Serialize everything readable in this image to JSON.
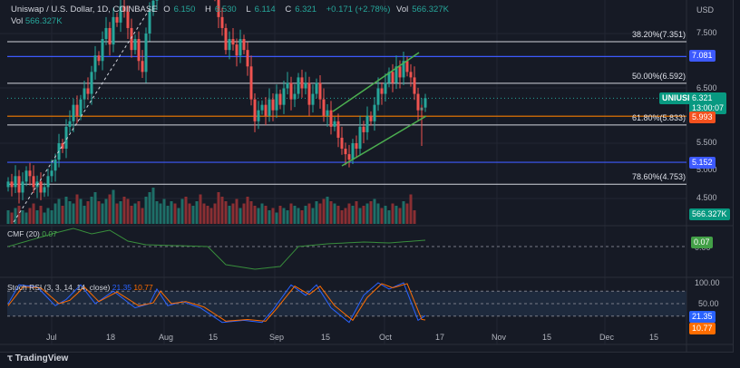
{
  "header": {
    "symbol": "Uniswap / U.S. Dollar, 1D, COINBASE",
    "o_label": "O",
    "o": "6.150",
    "h_label": "H",
    "h": "6.530",
    "l_label": "L",
    "l": "6.114",
    "c_label": "C",
    "c": "6.321",
    "change": "+0.171 (+2.78%)",
    "vol_label": "Vol",
    "vol": "566.327K"
  },
  "volume_legend": {
    "label": "Vol",
    "value": "566.327K"
  },
  "price_axis": {
    "currency": "USD",
    "ticks": [
      "7.500",
      "6.500",
      "5.500",
      "5.000",
      "4.500"
    ]
  },
  "price_labels": {
    "symbol_tag": "UNIUSD",
    "last_price": "6.321",
    "countdown": "13:00:07",
    "level_orange": "5.993",
    "level_blue_high": "7.081",
    "level_blue_low": "5.152",
    "volume": "566.327K"
  },
  "fib_levels": [
    {
      "label": "38.20%(7.351)",
      "price": 7.351
    },
    {
      "label": "50.00%(6.592)",
      "price": 6.592
    },
    {
      "label": "61.80%(5.833)",
      "price": 5.833
    },
    {
      "label": "78.60%(4.753)",
      "price": 4.753
    }
  ],
  "horizontal_levels": [
    {
      "price": 7.081,
      "color": "#3d5afe"
    },
    {
      "price": 5.152,
      "color": "#3d5afe"
    },
    {
      "price": 5.993,
      "color": "#f57c00"
    }
  ],
  "cmf": {
    "label": "CMF (20)",
    "value": "0.07",
    "zero_label": "0.00",
    "color": "#388e3c"
  },
  "stoch": {
    "label": "Stoch RSI (3, 3, 14, 14, close)",
    "k": "21.35",
    "d": "10.77",
    "ticks": [
      "100.00",
      "50.00"
    ],
    "k_color": "#2962ff",
    "d_color": "#ff6d00"
  },
  "time_axis": [
    "Jul",
    "18",
    "Aug",
    "15",
    "Sep",
    "15",
    "Oct",
    "17",
    "Nov",
    "15",
    "Dec",
    "15"
  ],
  "branding": "TradingView",
  "colors": {
    "up": "#26a69a",
    "down": "#ef5350",
    "channel": "#4caf50"
  },
  "chart_data": {
    "type": "candlestick",
    "title": "Uniswap / U.S. Dollar, 1D, COINBASE",
    "start_date": "2022-06-19",
    "ylim": [
      4.2,
      8.1
    ],
    "closes": [
      4.8,
      4.7,
      4.9,
      4.6,
      4.8,
      5.0,
      4.9,
      4.7,
      4.8,
      4.6,
      4.7,
      4.9,
      5.0,
      5.2,
      5.5,
      5.4,
      5.8,
      5.9,
      6.2,
      6.0,
      6.3,
      6.5,
      6.4,
      6.8,
      7.1,
      7.0,
      7.4,
      7.6,
      7.3,
      7.8,
      7.7,
      8.0,
      7.9,
      7.6,
      7.2,
      7.4,
      7.0,
      6.8,
      7.5,
      7.9,
      8.1,
      8.3,
      8.6,
      8.8,
      8.9,
      9.0,
      8.7,
      8.9,
      9.2,
      9.0,
      8.8,
      9.1,
      9.3,
      8.9,
      8.7,
      8.6,
      8.4,
      8.2,
      7.8,
      7.6,
      7.2,
      7.4,
      7.3,
      7.1,
      7.4,
      7.2,
      6.9,
      6.3,
      5.9,
      6.1,
      6.2,
      6.0,
      6.3,
      6.1,
      6.4,
      6.2,
      6.5,
      6.6,
      6.3,
      6.4,
      6.7,
      6.5,
      6.6,
      6.2,
      6.4,
      6.6,
      6.3,
      6.0,
      6.1,
      5.8,
      5.9,
      5.6,
      5.4,
      5.3,
      5.2,
      5.5,
      5.4,
      5.8,
      5.7,
      6.0,
      5.9,
      6.2,
      6.5,
      6.4,
      6.6,
      6.8,
      6.6,
      6.9,
      6.7,
      7.0,
      6.8,
      6.7,
      6.4,
      6.1,
      6.15,
      6.321
    ],
    "volumes_m": [
      6,
      5,
      7,
      8,
      6,
      5,
      7,
      9,
      6,
      8,
      5,
      7,
      6,
      9,
      11,
      8,
      12,
      10,
      9,
      13,
      11,
      8,
      10,
      12,
      14,
      10,
      9,
      11,
      13,
      15,
      9,
      10,
      12,
      11,
      8,
      9,
      10,
      7,
      12,
      14,
      16,
      10,
      9,
      11,
      8,
      10,
      9,
      7,
      11,
      12,
      9,
      8,
      10,
      13,
      9,
      8,
      7,
      9,
      14,
      12,
      10,
      8,
      9,
      11,
      7,
      9,
      12,
      10,
      8,
      7,
      9,
      8,
      6,
      7,
      5,
      8,
      7,
      6,
      9,
      8,
      7,
      6,
      8,
      9,
      7,
      10,
      9,
      11,
      12,
      10,
      9,
      8,
      6,
      7,
      9,
      8,
      10,
      7,
      8,
      9,
      10,
      11,
      9,
      7,
      8,
      6,
      9,
      8,
      7,
      10,
      9,
      13,
      6
    ],
    "cmf_points": [
      [
        -12,
        0.0
      ],
      [
        1,
        0.15
      ],
      [
        6,
        0.2
      ],
      [
        11,
        0.14
      ],
      [
        16,
        0.18
      ],
      [
        21,
        0.06
      ],
      [
        26,
        0.02
      ],
      [
        43,
        0.0
      ],
      [
        48,
        -0.2
      ],
      [
        56,
        -0.25
      ],
      [
        63,
        -0.22
      ],
      [
        68,
        0.0
      ],
      [
        76,
        0.03
      ],
      [
        86,
        0.05
      ],
      [
        93,
        0.04
      ],
      [
        103,
        0.07
      ]
    ],
    "stoch_k_points": [
      [
        -12,
        50
      ],
      [
        -9,
        95
      ],
      [
        -4,
        90
      ],
      [
        1,
        45
      ],
      [
        4,
        60
      ],
      [
        8,
        95
      ],
      [
        12,
        50
      ],
      [
        17,
        80
      ],
      [
        23,
        40
      ],
      [
        27,
        50
      ],
      [
        29,
        85
      ],
      [
        32,
        45
      ],
      [
        36,
        55
      ],
      [
        41,
        40
      ],
      [
        47,
        5
      ],
      [
        53,
        10
      ],
      [
        58,
        5
      ],
      [
        61,
        35
      ],
      [
        66,
        95
      ],
      [
        70,
        70
      ],
      [
        73,
        95
      ],
      [
        77,
        40
      ],
      [
        82,
        5
      ],
      [
        86,
        70
      ],
      [
        90,
        100
      ],
      [
        93,
        85
      ],
      [
        97,
        100
      ],
      [
        101,
        10
      ],
      [
        103,
        21.35
      ]
    ],
    "stoch_d_points": [
      [
        -12,
        45
      ],
      [
        -8,
        90
      ],
      [
        -3,
        88
      ],
      [
        2,
        50
      ],
      [
        5,
        58
      ],
      [
        9,
        90
      ],
      [
        13,
        55
      ],
      [
        18,
        78
      ],
      [
        24,
        45
      ],
      [
        28,
        52
      ],
      [
        30,
        80
      ],
      [
        33,
        50
      ],
      [
        37,
        55
      ],
      [
        42,
        42
      ],
      [
        48,
        8
      ],
      [
        54,
        12
      ],
      [
        59,
        8
      ],
      [
        62,
        38
      ],
      [
        67,
        92
      ],
      [
        71,
        72
      ],
      [
        74,
        92
      ],
      [
        78,
        45
      ],
      [
        83,
        10
      ],
      [
        87,
        65
      ],
      [
        91,
        98
      ],
      [
        94,
        88
      ],
      [
        98,
        98
      ],
      [
        102,
        12
      ],
      [
        103,
        10.77
      ]
    ]
  }
}
